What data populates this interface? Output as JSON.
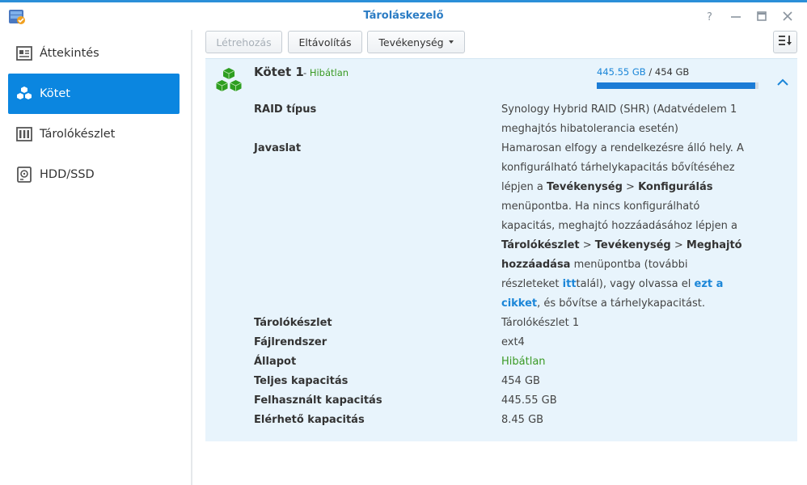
{
  "window": {
    "title": "Tároláskezelő"
  },
  "sidebar": {
    "items": [
      {
        "label": "Áttekintés",
        "icon": "overview-icon",
        "active": false
      },
      {
        "label": "Kötet",
        "icon": "volume-cubes-icon",
        "active": true
      },
      {
        "label": "Tárolókészlet",
        "icon": "storage-pool-icon",
        "active": false
      },
      {
        "label": "HDD/SSD",
        "icon": "hdd-icon",
        "active": false
      }
    ]
  },
  "toolbar": {
    "create_label": "Létrehozás",
    "remove_label": "Eltávolítás",
    "action_label": "Tevékenység"
  },
  "volume": {
    "title": "Kötet 1",
    "status_sep": "- ",
    "status": "Hibátlan",
    "used": "445.55 GB",
    "cap_sep": " / ",
    "total": "454 GB",
    "usage_fraction": 0.981,
    "details": {
      "raid_label": "RAID típus",
      "raid_value": "Synology Hybrid RAID (SHR) (Adatvédelem 1 meghajtós hibatolerancia esetén)",
      "suggestion_label": "Javaslat",
      "suggestion": {
        "t1": "Hamarosan elfogy a rendelkezésre álló hely. A konfigurálható tárhelykapacitás bővítéséhez lépjen a ",
        "b1": "Tevékenység",
        "t2": " > ",
        "b2": "Konfigurálás",
        "t3": " menüpontba. Ha nincs konfigurálható kapacitás, meghajtó hozzáadásához lépjen a ",
        "b3": "Tárolókészlet",
        "t4": " > ",
        "b4": "Tevékenység",
        "t5": " > ",
        "b5": "Meghajtó hozzáadása",
        "t6": " menüpontba (további részleteket ",
        "link1": "itt",
        "t7": "talál), vagy olvassa el ",
        "link2": "ezt a cikket",
        "t8": ", és bővítse a tárhelykapacitást."
      },
      "pool_label": "Tárolókészlet",
      "pool_value": "Tárolókészlet 1",
      "fs_label": "Fájlrendszer",
      "fs_value": "ext4",
      "state_label": "Állapot",
      "state_value": "Hibátlan",
      "total_label": "Teljes kapacitás",
      "total_value": "454 GB",
      "used_label": "Felhasznált kapacitás",
      "used_value": "445.55 GB",
      "avail_label": "Elérhető kapacitás",
      "avail_value": "8.45 GB"
    }
  },
  "colors": {
    "accent": "#0b86e0",
    "link": "#1b86d8",
    "healthy": "#3a9a24",
    "panel_bg": "#e8f4fc",
    "cube_green": "#2e9e20"
  }
}
